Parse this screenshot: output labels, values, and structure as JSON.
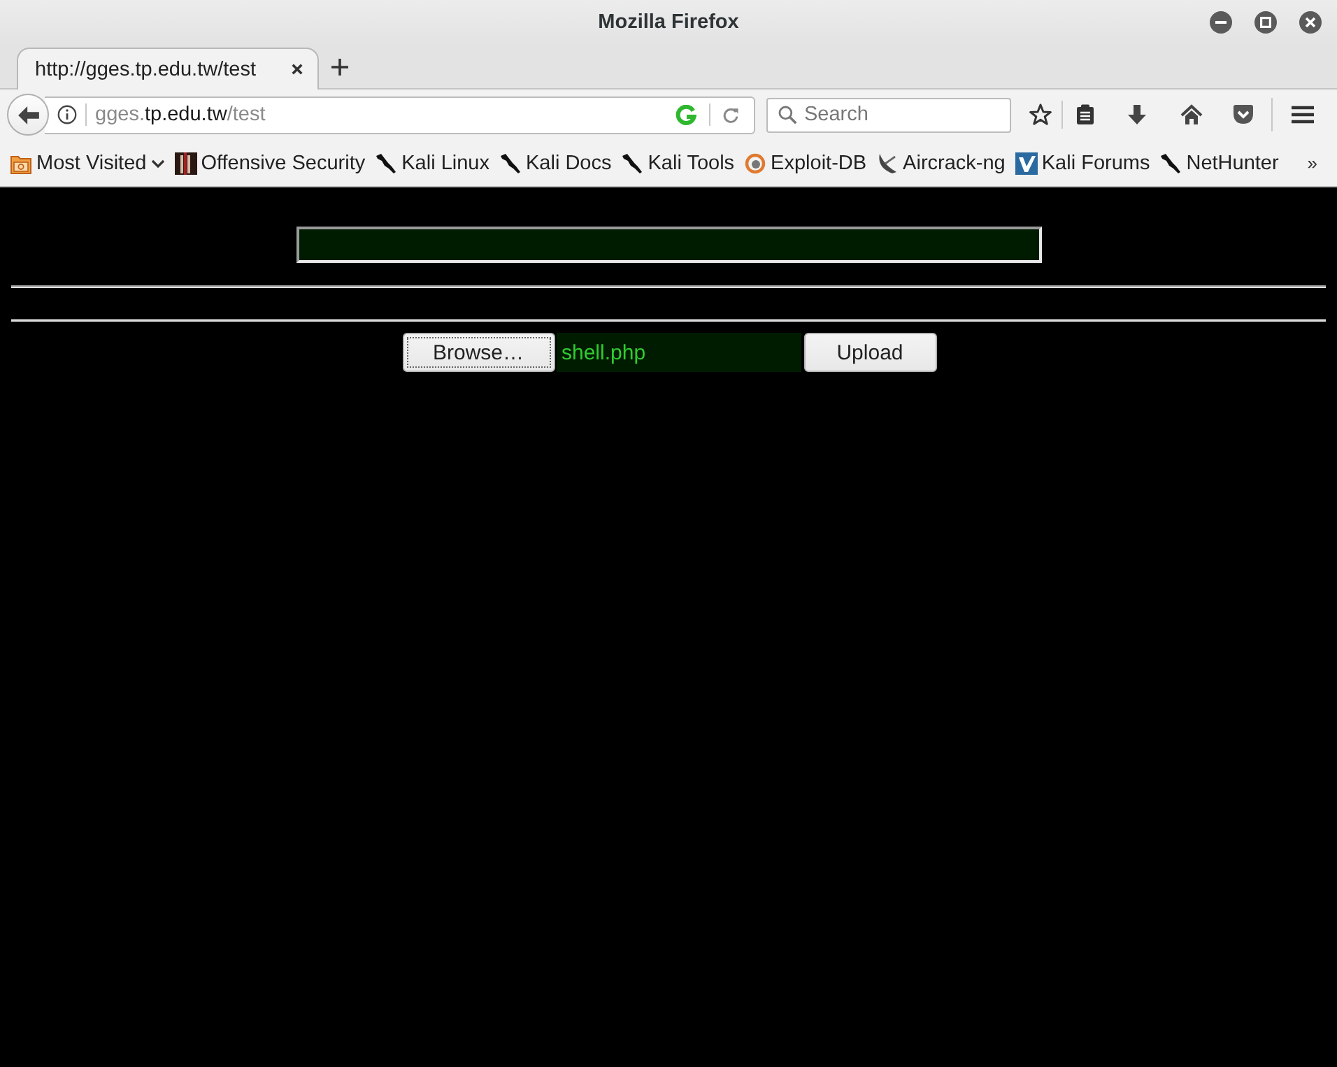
{
  "window": {
    "title": "Mozilla Firefox"
  },
  "tabs": [
    {
      "label": "http://gges.tp.edu.tw/test",
      "selected": true
    }
  ],
  "address_bar": {
    "host_prefix": "gges.",
    "domain": "tp.edu.tw",
    "path": "/test"
  },
  "search": {
    "placeholder": "Search"
  },
  "bookmarks": [
    {
      "label": "Most Visited",
      "kind": "folder"
    },
    {
      "label": "Offensive Security",
      "kind": "tile"
    },
    {
      "label": "Kali Linux",
      "kind": "squiggle"
    },
    {
      "label": "Kali Docs",
      "kind": "squiggle"
    },
    {
      "label": "Kali Tools",
      "kind": "squiggle"
    },
    {
      "label": "Exploit-DB",
      "kind": "ring"
    },
    {
      "label": "Aircrack-ng",
      "kind": "dish"
    },
    {
      "label": "Kali Forums",
      "kind": "vtile"
    },
    {
      "label": "NetHunter",
      "kind": "squiggle"
    }
  ],
  "bookmarks_overflow": "»",
  "page": {
    "browse_button": "Browse…",
    "file_name": "shell.php",
    "upload_button": "Upload"
  }
}
